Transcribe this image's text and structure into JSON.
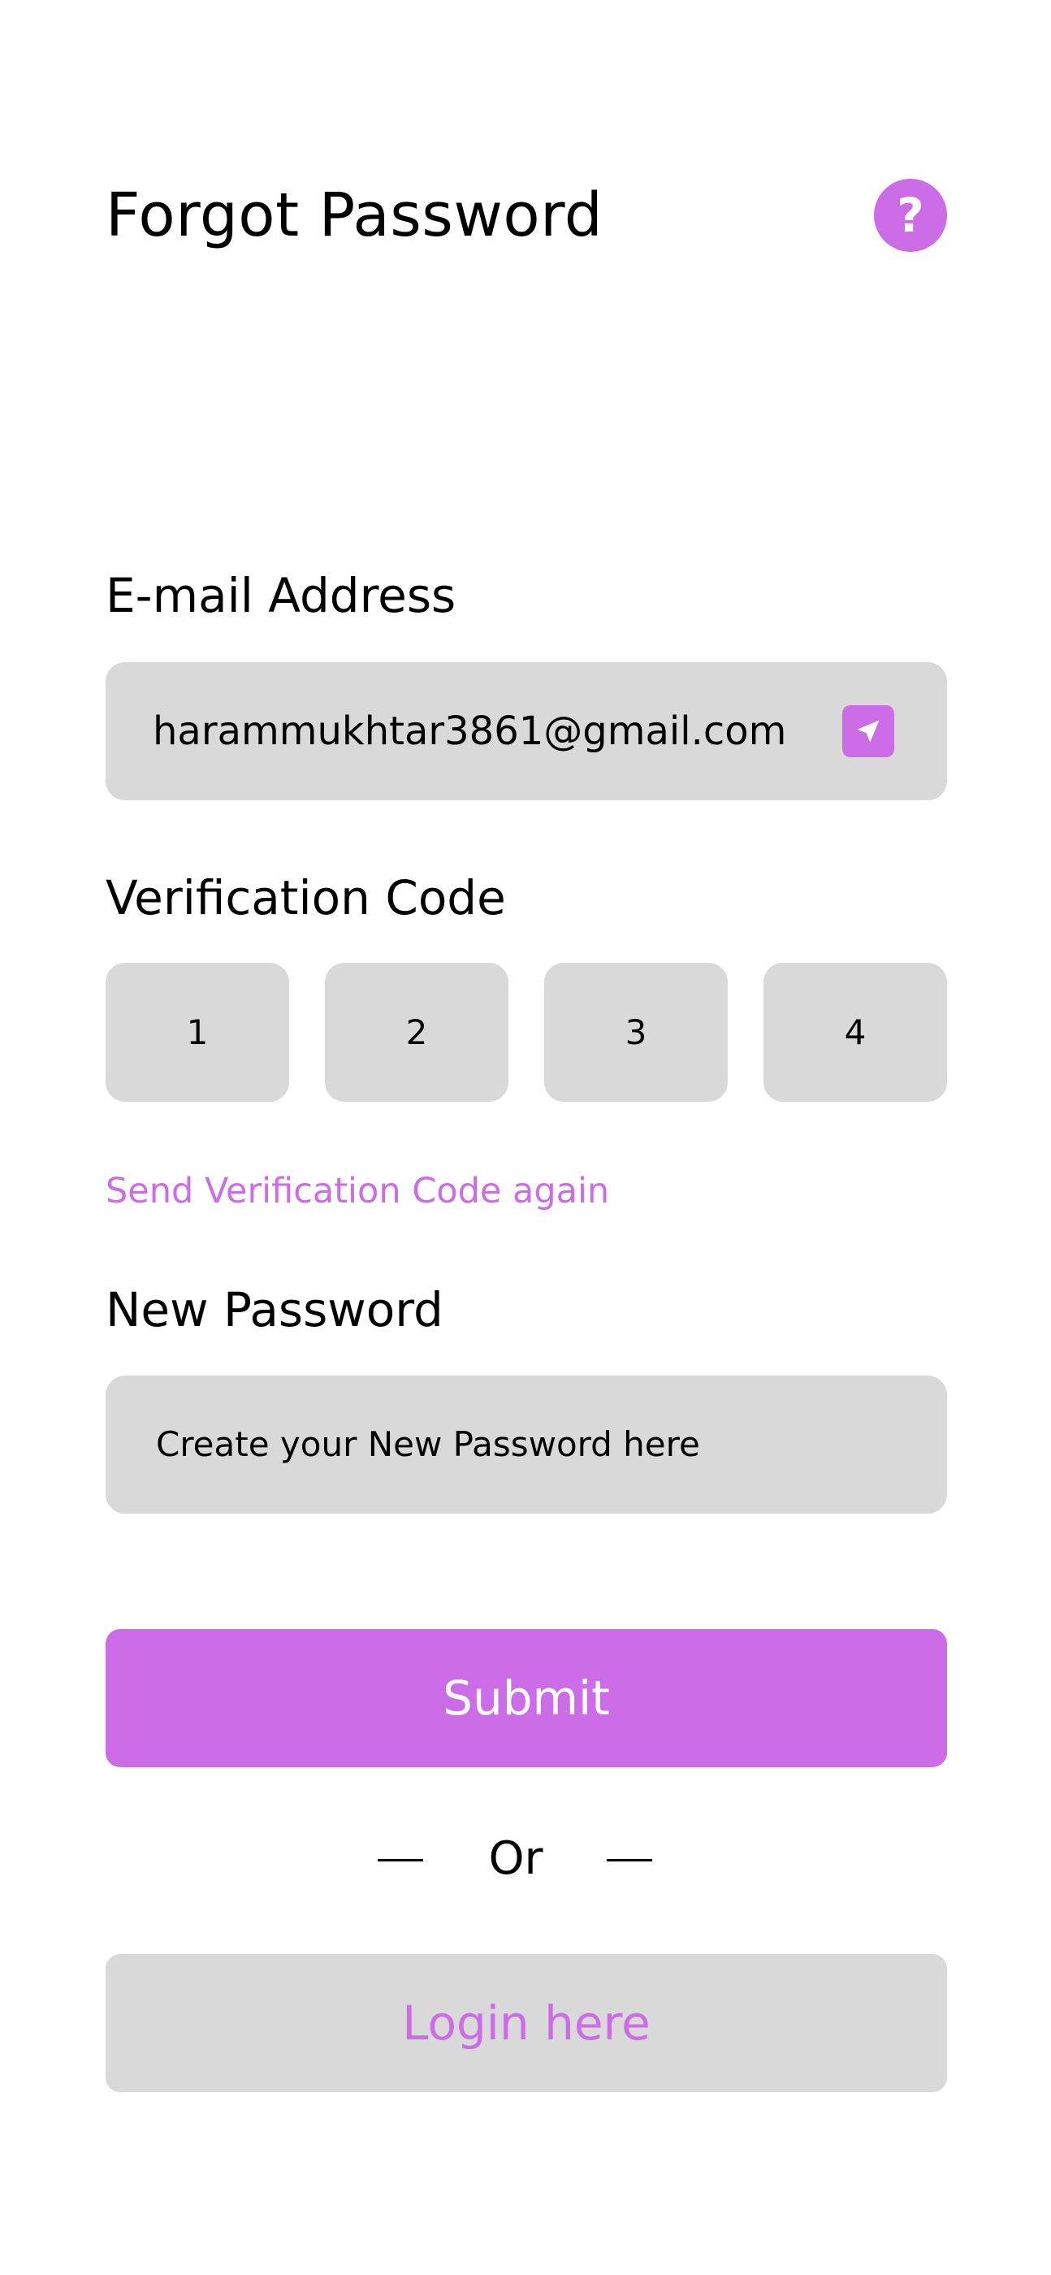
{
  "header": {
    "title": "Forgot Password",
    "help_icon": "question-mark-icon",
    "help_label": "?"
  },
  "email": {
    "label": "E-mail Address",
    "value": "harammukhtar3861@gmail.com",
    "send_icon": "send-arrow-icon"
  },
  "verification": {
    "label": "Verification Code",
    "digits": [
      "1",
      "2",
      "3",
      "4"
    ],
    "resend_link": "Send Verification Code again"
  },
  "new_password": {
    "label": "New Password",
    "placeholder": "Create your New Password here"
  },
  "actions": {
    "submit_label": "Submit",
    "divider_text": "Or",
    "login_label": "Login here"
  },
  "colors": {
    "accent": "#cc6ce6",
    "field_background": "#d9d9d9",
    "text": "#000000",
    "background": "#ffffff"
  }
}
